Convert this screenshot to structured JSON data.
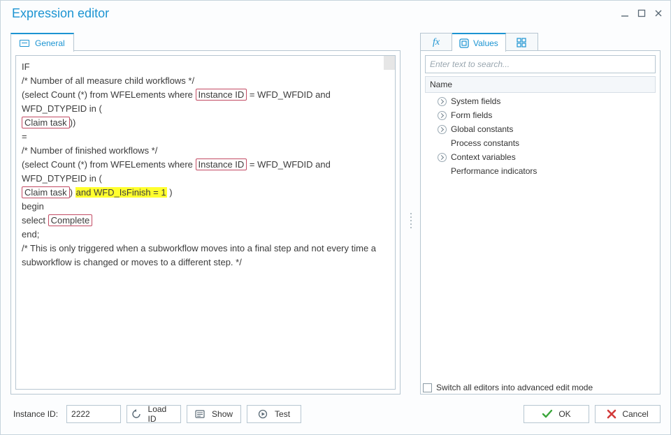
{
  "title": "Expression editor",
  "leftTab": {
    "label": "General"
  },
  "editor": {
    "line1": "IF",
    "line2": "/* Number of all measure child workflows */",
    "line3a": "  (select Count (*) from WFELements where ",
    "tag_instance": "Instance ID",
    "line3b": " = WFD_WFDID and WFD_DTYPEID in (",
    "tag_claim": "Claim task",
    "line4b": "))",
    "line5": "=",
    "line6": " /* Number of finished workflows */",
    "line7a": "  (select Count (*) from WFELements where ",
    "line7b": " = WFD_WFDID and WFD_DTYPEID in (",
    "line8mid": ") ",
    "highlight": "and WFD_IsFinish = 1",
    "line8end": " )",
    "line9": "  begin",
    "line10a": "     select ",
    "tag_complete": "Complete",
    "line11": "end;",
    "line12": "/* This is only triggered when a subworkflow moves into a final step and not every time a subworkflow is changed or moves to a different step. */"
  },
  "footer": {
    "instance_label": "Instance ID:",
    "instance_value": "2222",
    "load": "Load ID",
    "show": "Show",
    "test": "Test"
  },
  "right": {
    "tab_values": "Values",
    "search_placeholder": "Enter text to search...",
    "tree_header": "Name",
    "items": {
      "0": "System fields",
      "1": "Form fields",
      "2": "Global constants",
      "3": "Process constants",
      "4": "Context variables",
      "5": "Performance indicators"
    },
    "switch_label": "Switch all editors into advanced edit mode",
    "ok": "OK",
    "cancel": "Cancel"
  }
}
